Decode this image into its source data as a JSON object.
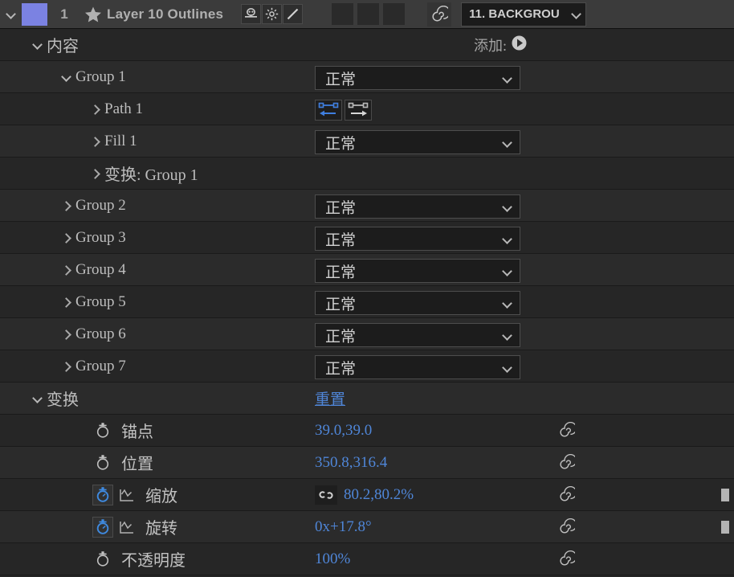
{
  "header": {
    "twirl_icon": "chevron-down-icon",
    "color_swatch": "#7b82e2",
    "layer_number": "1",
    "star_icon": "star-icon",
    "layer_title": "Layer 10 Outlines",
    "switches": [
      {
        "icon": "motion-blur-icon"
      },
      {
        "icon": "sun-icon"
      },
      {
        "icon": "slash-icon"
      }
    ],
    "blank_switches": [
      {
        "icon": "blank-switch-icon"
      },
      {
        "icon": "blank-switch-icon"
      },
      {
        "icon": "blank-switch-icon"
      }
    ],
    "expression_icon": "spiral-icon",
    "comp_select": {
      "label": "11. BACKGROU",
      "chevron": "chevron-down-icon"
    }
  },
  "contents": {
    "twirl": "chevron-down-icon",
    "label": "内容",
    "add_label": "添加:",
    "add_icon": "add-circle-icon"
  },
  "groups": [
    {
      "name": "Group 1",
      "twirl": "chevron-down-icon",
      "expanded": true,
      "mode": "正常",
      "children": [
        {
          "name": "Path 1",
          "twirl": "chevron-right-icon",
          "type": "path",
          "icons": [
            {
              "name": "path-direction-reverse-icon",
              "active": true
            },
            {
              "name": "path-direction-forward-icon",
              "active": false
            }
          ]
        },
        {
          "name": "Fill 1",
          "twirl": "chevron-right-icon",
          "type": "mode",
          "mode": "正常"
        },
        {
          "name": "变换: Group 1",
          "twirl": "chevron-right-icon",
          "type": "plain"
        }
      ]
    },
    {
      "name": "Group 2",
      "twirl": "chevron-right-icon",
      "expanded": false,
      "mode": "正常"
    },
    {
      "name": "Group 3",
      "twirl": "chevron-right-icon",
      "expanded": false,
      "mode": "正常"
    },
    {
      "name": "Group 4",
      "twirl": "chevron-right-icon",
      "expanded": false,
      "mode": "正常"
    },
    {
      "name": "Group 5",
      "twirl": "chevron-right-icon",
      "expanded": false,
      "mode": "正常"
    },
    {
      "name": "Group 6",
      "twirl": "chevron-right-icon",
      "expanded": false,
      "mode": "正常"
    },
    {
      "name": "Group 7",
      "twirl": "chevron-right-icon",
      "expanded": false,
      "mode": "正常"
    }
  ],
  "transform": {
    "twirl": "chevron-down-icon",
    "label": "变换",
    "reset_label": "重置",
    "properties": [
      {
        "label": "锚点",
        "value": "39.0,39.0",
        "stopwatch": "stopwatch-icon",
        "stopwatch_active": false,
        "graph_icon": null,
        "link_icon": null,
        "expression_icon": "spiral-icon",
        "keyframe_nav": false
      },
      {
        "label": "位置",
        "value": "350.8,316.4",
        "stopwatch": "stopwatch-icon",
        "stopwatch_active": false,
        "graph_icon": null,
        "link_icon": null,
        "expression_icon": "spiral-icon",
        "keyframe_nav": false
      },
      {
        "label": "缩放",
        "value": "80.2,80.2%",
        "stopwatch": "stopwatch-icon",
        "stopwatch_active": true,
        "graph_icon": "graph-editor-icon",
        "link_icon": "constrain-proportions-icon",
        "expression_icon": "spiral-icon",
        "keyframe_nav": true
      },
      {
        "label": "旋转",
        "value": "0x+17.8°",
        "stopwatch": "stopwatch-icon",
        "stopwatch_active": true,
        "graph_icon": "graph-editor-icon",
        "link_icon": null,
        "expression_icon": "spiral-icon",
        "keyframe_nav": true
      },
      {
        "label": "不透明度",
        "value": "100%",
        "stopwatch": "stopwatch-icon",
        "stopwatch_active": false,
        "graph_icon": null,
        "link_icon": null,
        "expression_icon": "spiral-icon",
        "keyframe_nav": false
      }
    ]
  },
  "colors": {
    "accent_blue": "#4f86d8",
    "swatch_purple": "#7b82e2",
    "panel_bg": "#242424",
    "header_bg": "#3b3b3b",
    "text_gray": "#bdbdbd"
  }
}
